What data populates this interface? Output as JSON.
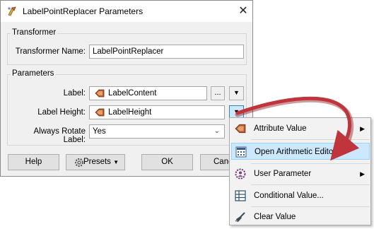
{
  "window": {
    "title": "LabelPointReplacer Parameters",
    "close": "✕"
  },
  "transformer": {
    "group_label": "Transformer",
    "name_label": "Transformer Name:",
    "name_value": "LabelPointReplacer"
  },
  "parameters": {
    "group_label": "Parameters",
    "label_label": "Label:",
    "label_value": "LabelContent",
    "label_ellipsis": "...",
    "label_height_label": "Label Height:",
    "label_height_value": "LabelHeight",
    "always_rotate_label": "Always Rotate Label:",
    "always_rotate_value": "Yes"
  },
  "buttons": {
    "help": "Help",
    "presets": "Presets",
    "ok": "OK",
    "cancel": "Canc"
  },
  "menu": {
    "items": [
      {
        "label": "Attribute Value",
        "icon": "attribute-icon",
        "submenu": true
      },
      {
        "label": "Open Arithmetic Editor...",
        "icon": "calculator-icon",
        "submenu": false,
        "highlighted": true
      },
      {
        "label": "User Parameter",
        "icon": "user-parameter-icon",
        "submenu": true
      },
      {
        "label": "Conditional Value...",
        "icon": "table-icon",
        "submenu": false
      },
      {
        "label": "Clear Value",
        "icon": "broom-icon",
        "submenu": false
      }
    ]
  },
  "colors": {
    "arrow": "#c0343c",
    "highlight": "#cce8ff",
    "attribute_icon": "#b85c2a"
  }
}
